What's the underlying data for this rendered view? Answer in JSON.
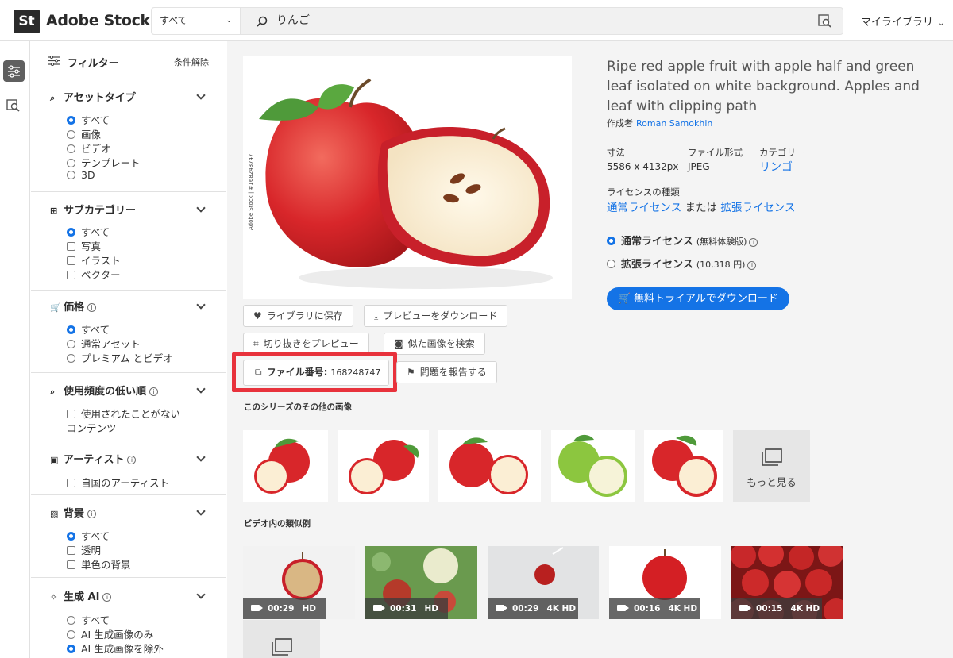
{
  "header": {
    "logo_mark": "St",
    "logo_text": "Adobe Stock",
    "search_type": "すべて",
    "search_query": "りんご",
    "library_label": "マイライブラリ"
  },
  "sidebar": {
    "title": "フィルター",
    "clear_label": "条件解除",
    "sections": {
      "asset_type": {
        "title": "アセットタイプ",
        "options": [
          "すべて",
          "画像",
          "ビデオ",
          "テンプレート",
          "3D"
        ]
      },
      "subcategory": {
        "title": "サブカテゴリー",
        "options": [
          "すべて",
          "写真",
          "イラスト",
          "ベクター"
        ]
      },
      "price": {
        "title": "価格",
        "options": [
          "すべて",
          "通常アセット",
          "プレミアム とビデオ"
        ]
      },
      "usage": {
        "title": "使用頻度の低い順",
        "options": [
          "使用されたことがない",
          "コンテンツ"
        ]
      },
      "artist": {
        "title": "アーティスト",
        "options": [
          "自国のアーティスト"
        ]
      },
      "background": {
        "title": "背景",
        "options": [
          "すべて",
          "透明",
          "単色の背景"
        ]
      },
      "gen_ai": {
        "title": "生成 AI",
        "options": [
          "すべて",
          "AI 生成画像のみ",
          "AI 生成画像を除外"
        ]
      }
    }
  },
  "asset": {
    "watermark": "Adobe Stock | #168248747",
    "title": "Ripe red apple fruit with apple half and green leaf isolated on white background. Apples and leaf with clipping path",
    "author_label": "作成者",
    "author_name": "Roman Samokhin",
    "size_label": "寸法",
    "size_value": "5586 x 4132px",
    "format_label": "ファイル形式",
    "format_value": "JPEG",
    "category_label": "カテゴリー",
    "category_value": "リンゴ",
    "license_type_label": "ライセンスの種類",
    "license_standard": "通常ライセンス",
    "license_or": "または",
    "license_extended": "拡張ライセンス",
    "opt_standard": "通常ライセンス",
    "opt_standard_note": "(無料体験版)",
    "opt_extended": "拡張ライセンス",
    "opt_extended_note": "(10,318 円)",
    "download_button": "無料トライアルでダウンロード"
  },
  "actions": {
    "save_library": "ライブラリに保存",
    "download_preview": "プレビューをダウンロード",
    "crop_preview": "切り抜きをプレビュー",
    "find_similar": "似た画像を検索",
    "file_id_label": "ファイル番号:",
    "file_id_value": "168248747",
    "report": "問題を報告する"
  },
  "series": {
    "label": "このシリーズのその他の画像",
    "more_label": "もっと見る"
  },
  "videos": {
    "label": "ビデオ内の類似例",
    "items": [
      {
        "duration": "00:29",
        "quality": "HD"
      },
      {
        "duration": "00:31",
        "quality": "HD"
      },
      {
        "duration": "00:29",
        "quality": "4K   HD"
      },
      {
        "duration": "00:16",
        "quality": "4K   HD"
      },
      {
        "duration": "00:15",
        "quality": "4K   HD"
      }
    ]
  },
  "colors": {
    "accent": "#1473e6",
    "highlight": "#e8323c"
  }
}
